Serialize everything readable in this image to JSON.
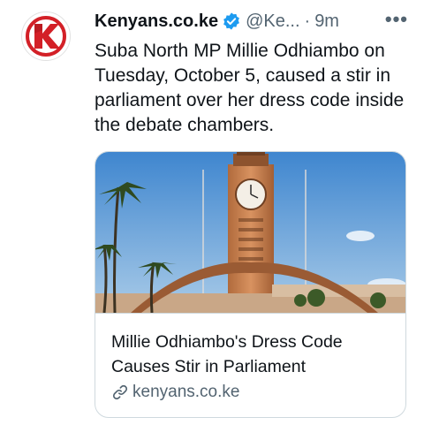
{
  "tweet": {
    "author_name": "Kenyans.co.ke",
    "handle": "@Ke...",
    "separator": "·",
    "time": "9m",
    "more_icon_label": "•••",
    "text": "Suba North MP Millie Odhiambo on Tuesday, October 5, caused a stir in parliament over her dress code inside the debate chambers.",
    "verified_icon": "verified-badge-icon",
    "avatar_icon": "kenyans-logo"
  },
  "card": {
    "image_icon": "parliament-clock-tower-photo",
    "title": "Millie Odhiambo's Dress Code Causes Stir in Parliament",
    "domain": "kenyans.co.ke",
    "link_icon": "link-icon"
  },
  "colors": {
    "brand_red": "#d32027",
    "verified_blue": "#1d9bf0",
    "text_primary": "#0f1419",
    "text_secondary": "#536471",
    "border": "#cfd9de"
  }
}
